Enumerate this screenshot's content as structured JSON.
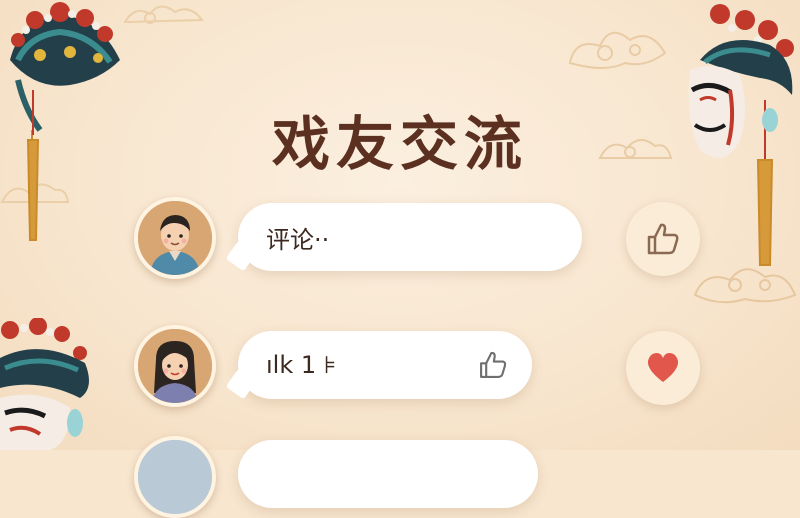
{
  "header": {
    "title": "戏友交流"
  },
  "comments": [
    {
      "avatar": "male-avatar",
      "text": "评论··",
      "inline_icon": "",
      "action_icon": "thumbs-up-icon",
      "liked": false
    },
    {
      "avatar": "female-avatar",
      "text": "ılk 1 ⊧",
      "inline_icon": "thumbs-up-icon",
      "action_icon": "heart-icon",
      "liked": true
    },
    {
      "avatar": "avatar-partial",
      "text": "",
      "inline_icon": "",
      "action_icon": "",
      "liked": false
    }
  ],
  "colors": {
    "background": "#f8e6cf",
    "title": "#5b3021",
    "heart": "#e2574c",
    "thumb": "#8a6a52"
  }
}
